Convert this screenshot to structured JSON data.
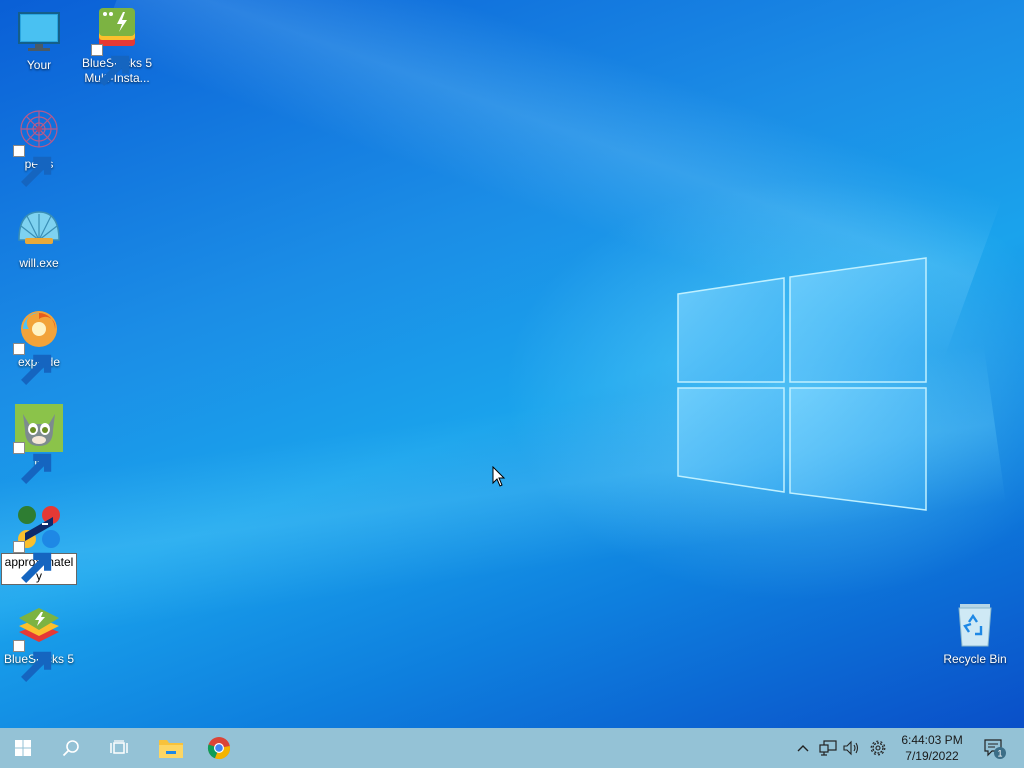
{
  "desktop": {
    "icons": [
      {
        "label": "Your",
        "icon": "monitor-icon",
        "shortcut": false
      },
      {
        "label": "BlueStacks 5 Multi-Insta...",
        "icon": "bluestacks-multi-icon",
        "shortcut": true
      },
      {
        "label": "penis",
        "icon": "pattern-icon",
        "shortcut": true
      },
      {
        "label": "will.exe",
        "icon": "shell-icon",
        "shortcut": false
      },
      {
        "label": "explode",
        "icon": "swirl-icon",
        "shortcut": true
      },
      {
        "label": "in",
        "icon": "talking-tom-icon",
        "shortcut": true
      },
      {
        "label": "approximately",
        "icon": "colorful-app-icon",
        "shortcut": true,
        "selected": true
      },
      {
        "label": "BlueStacks 5",
        "icon": "bluestacks-icon",
        "shortcut": true
      },
      {
        "label": "Recycle Bin",
        "icon": "recycle-bin-icon",
        "shortcut": false
      }
    ]
  },
  "taskbar": {
    "start": "windows-start-icon",
    "search": "search-icon",
    "task_view": "task-view-icon",
    "pinned": [
      "file-explorer-icon",
      "chrome-icon"
    ],
    "tray": [
      "chevron-up-icon",
      "network-icon",
      "volume-icon",
      "settings-gear-icon"
    ],
    "clock": {
      "time": "6:44:03 PM",
      "date": "7/19/2022"
    },
    "notifications": {
      "count": "1"
    }
  },
  "colors": {
    "taskbar": "#94c2d6",
    "desktop_accent": "#1a8fe6"
  }
}
